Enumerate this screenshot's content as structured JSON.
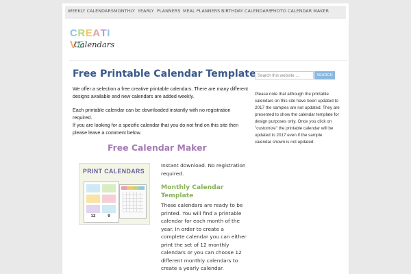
{
  "nav": {
    "items": [
      "WEEKLY CALENDARS",
      "MONTHLY",
      "YEARLY",
      "PLANNERS",
      "MEAL PLANNERS",
      "BIRTHDAY CALENDARS",
      "PHOTO CALENDAR MAKER"
    ]
  },
  "logo": {
    "top": "CREATIVE",
    "bottom": "Calendars",
    "colors": [
      "#8ec5e6",
      "#b9d67a",
      "#f3c66b",
      "#e8a0a8",
      "#b79ad1",
      "#8ec5e6",
      "#f1a96a",
      "#9fd3c7"
    ]
  },
  "main": {
    "title": "Free Printable Calendar Templates",
    "para1": "We offer a selection a free creative printable calendars. There are many different designs available and new calendars are added weekly.",
    "para2": "Each printable calendar can be downloaded instantly with no registration required.",
    "para3": "If you are looking for a specific calendar that you do not find on this site then please leave a comment below.",
    "subhead": "Free Calendar Maker",
    "thumb_title": "PRINT CALENDARS",
    "thumb_numbers": [
      "12",
      "9"
    ],
    "instant": "Instant download. No registration required.",
    "mct_title": "Monthly Calendar Template",
    "mct_text": "These calendars are ready to be printed. You will find a printable calendar for each month of the year. In order to create a complete calendar you can either print the set of 12 monthly calendars or you can choose 12 different monthly calendars to create a yearly calendar."
  },
  "sidebar": {
    "search_placeholder": "Search this website ...",
    "search_button": "SEARCH",
    "notice": "Please note that although the printable calendars on this site have been updated to 2017 the samples are not updated. They are presented to show the calendar template for design purposes only. Once you click on \"customize\" the printable calendar will be updated to 2017 even if the sample calendar shown is not updated."
  }
}
